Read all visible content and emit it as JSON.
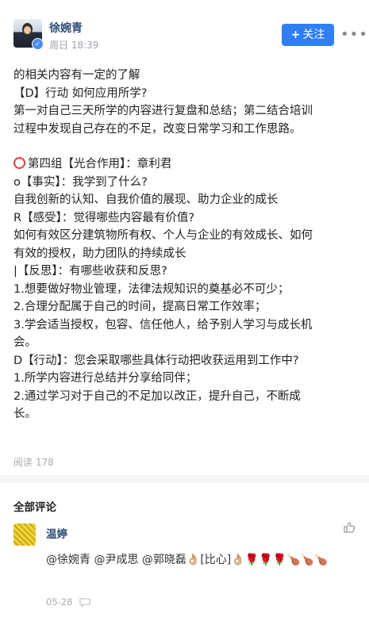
{
  "header": {
    "author": "徐婉青",
    "time": "周日 18:39",
    "follow_label": "关注",
    "more": "•••"
  },
  "post": {
    "lines": [
      "的相关内容有一定的了解",
      "【D】行动 如何应用所学?",
      "第一对自己三天所学的内容进行复盘和总结；第二结合培训",
      "过程中发现自己存在的不足，改变日常学习和工作思路。",
      "",
      "第四组【光合作用】：章利君",
      "o【事实】：我学到了什么?",
      "自我创新的认知、自我价值的展现、助力企业的成长",
      "R【感受】：觉得哪些内容最有价值?",
      "如何有效区分建筑物所有权、个人与企业的有效成长、如何",
      "有效的授权，助力团队的持续成长",
      "|【反思】：有哪些收获和反思?",
      "1.想要做好物业管理，法律法规知识的奠基必不可少；",
      "2.合理分配属于自己的时间，提高日常工作效率；",
      "3.学会适当授权，包容、信任他人，给予别人学习与成长机",
      "会。",
      "D【行动】：您会采取哪些具体行动把收获运用到工作中?",
      "1.所学内容进行总结并分享给同伴；",
      "2.通过学习对于自己的不足加以改正，提升自己，不断成",
      "长。"
    ],
    "read_count": "阅读 178"
  },
  "comments": {
    "title": "全部评论",
    "items": [
      {
        "name": "温婷",
        "text": "@徐婉青 @尹成思 @郭晓磊👌🏼[比心]👌🏼🌹🌹🌹🍗🍗🍗",
        "date": "05-28"
      }
    ]
  },
  "colors": {
    "accent": "#2f7ff3",
    "name": "#2f4d7a",
    "muted": "#a8abb1"
  }
}
